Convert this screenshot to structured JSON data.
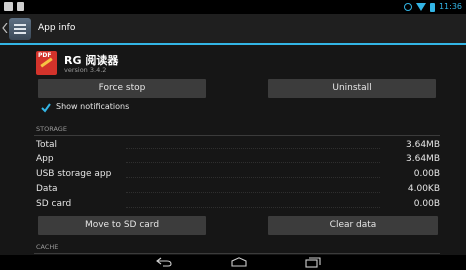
{
  "status_bar": {
    "time": "11:36",
    "left_icons": [
      "screenshot-icon",
      "notification-icon"
    ],
    "right_icons": [
      "alarm-icon",
      "wifi-icon",
      "battery-icon"
    ]
  },
  "action_bar": {
    "title": "App info"
  },
  "app": {
    "name": "RG 阅读器",
    "version": "version 3.4.2",
    "icon_text": "PDF"
  },
  "buttons": {
    "force_stop": "Force stop",
    "uninstall": "Uninstall",
    "move_to_sd": "Move to SD card",
    "clear_data": "Clear data"
  },
  "notifications": {
    "label": "Show notifications",
    "checked": true
  },
  "storage": {
    "header": "STORAGE",
    "rows": [
      {
        "label": "Total",
        "value": "3.64MB"
      },
      {
        "label": "App",
        "value": "3.64MB"
      },
      {
        "label": "USB storage app",
        "value": "0.00B"
      },
      {
        "label": "Data",
        "value": "4.00KB"
      },
      {
        "label": "SD card",
        "value": "0.00B"
      }
    ]
  },
  "cache": {
    "header": "CACHE"
  },
  "nav_bar": {
    "buttons": [
      "back-icon",
      "home-icon",
      "recents-icon"
    ]
  },
  "colors": {
    "accent": "#33b5e5",
    "button_bg": "#3c3c3c",
    "background": "#161616"
  }
}
